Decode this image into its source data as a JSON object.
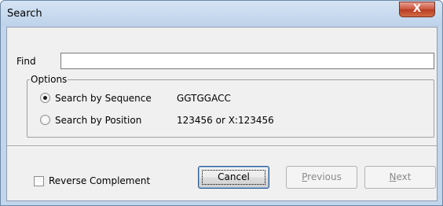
{
  "window": {
    "title": "Search",
    "close_label": "X"
  },
  "find": {
    "label": "Find",
    "value": ""
  },
  "options": {
    "legend": "Options",
    "radios": [
      {
        "label": "Search by Sequence",
        "example": "GGTGGACC",
        "selected": true
      },
      {
        "label": "Search by Position",
        "example": "123456 or X:123456",
        "selected": false
      }
    ]
  },
  "reverse_complement": {
    "label": "Reverse Complement",
    "checked": false
  },
  "buttons": {
    "cancel": "Cancel",
    "previous_first": "P",
    "previous_rest": "revious",
    "next_first": "N",
    "next_rest": "ext"
  },
  "colors": {
    "title_bar": "#c1d6ec",
    "close_button": "#c7533a",
    "dialog_bg": "#f0f0f0",
    "disabled_text": "#8a8a8a"
  }
}
